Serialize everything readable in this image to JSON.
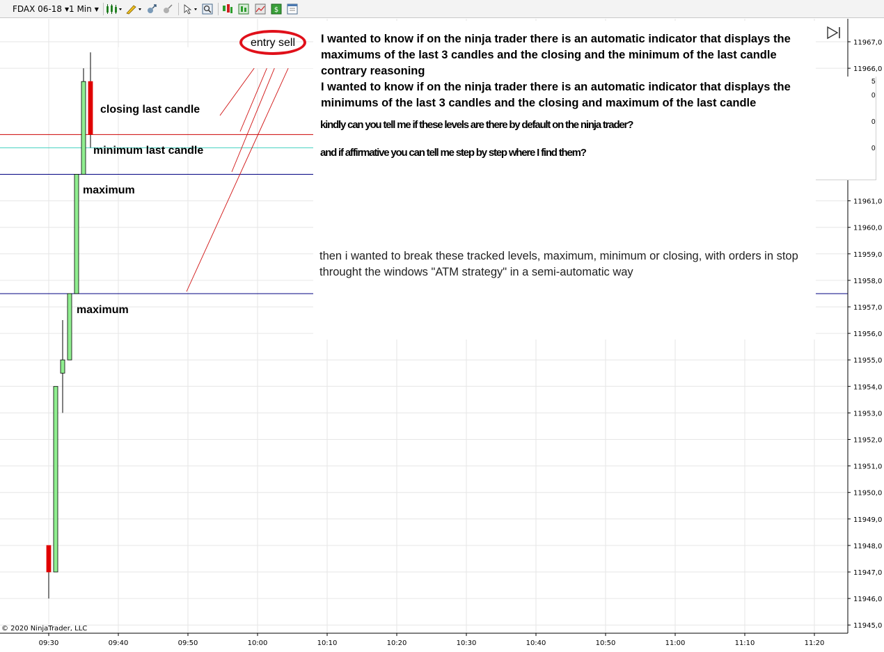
{
  "toolbar": {
    "instrument": "FDAX 06-18",
    "interval": "1 Min",
    "icons": [
      "bar-style-icon",
      "drawing-tools-icon",
      "snap-mode-icon",
      "pan-icon",
      "select-icon",
      "zoom-icon",
      "indicators-icon",
      "strategies-icon",
      "templates-icon",
      "order-entry-icon",
      "properties-icon"
    ]
  },
  "chart_data": {
    "type": "candlestick",
    "y_ticks": [
      "11967,0",
      "11966,0",
      "11961,0",
      "11960,0",
      "11959,0",
      "11958,0",
      "11957,0",
      "11956,0",
      "11955,0",
      "11954,0",
      "11953,0",
      "11952,0",
      "11951,0",
      "11950,0",
      "11949,0",
      "11948,0",
      "11947,0",
      "11946,0",
      "11945,0"
    ],
    "x_ticks": [
      "09:30",
      "09:40",
      "09:50",
      "10:00",
      "10:10",
      "10:20",
      "10:30",
      "10:40",
      "10:50",
      "11:00",
      "11:10",
      "11:20"
    ],
    "ylim": [
      11944.8,
      11967.4
    ],
    "candles": [
      {
        "time": "09:30",
        "open": 11948.0,
        "high": 11948.0,
        "low": 11946.0,
        "close": 11947.0
      },
      {
        "time": "09:31",
        "open": 11947.0,
        "high": 11954.0,
        "low": 11947.0,
        "close": 11954.0
      },
      {
        "time": "09:32",
        "open": 11954.5,
        "high": 11956.5,
        "low": 11953.0,
        "close": 11955.0
      },
      {
        "time": "09:33",
        "open": 11955.0,
        "high": 11957.5,
        "low": 11955.0,
        "close": 11957.5
      },
      {
        "time": "09:34",
        "open": 11957.5,
        "high": 11962.0,
        "low": 11957.5,
        "close": 11962.0
      },
      {
        "time": "09:35",
        "open": 11962.0,
        "high": 11966.0,
        "low": 11962.0,
        "close": 11965.5
      },
      {
        "time": "09:36",
        "open": 11965.5,
        "high": 11966.6,
        "low": 11963.0,
        "close": 11963.5
      }
    ],
    "levels": [
      {
        "name": "closing last candle",
        "price": 11963.5,
        "color": "#cc0000"
      },
      {
        "name": "minimum last candle",
        "price": 11963.0,
        "color": "#40d0c0"
      },
      {
        "name": "maximum",
        "price": 11962.0,
        "color": "#000080"
      },
      {
        "name": "maximum",
        "price": 11957.5,
        "color": "#000080"
      }
    ],
    "colors": {
      "up": "#90ee90",
      "down": "#e00000",
      "grid": "#e6e6e6",
      "wick": "#000000"
    }
  },
  "annotations": {
    "entry_sell": "entry sell",
    "closing_last_candle": "closing last candle",
    "minimum_last_candle": "minimum last candle",
    "maximum_upper": "maximum",
    "maximum_lower": "maximum",
    "question_line1": "I wanted to know if on the ninja trader there is an automatic indicator that displays the maximums of the last 3 candles and the closing and the minimum of the last candle",
    "question_line2": "contrary reasoning",
    "question_line3": "I wanted to know if on the ninja trader there is an automatic indicator that displays the minimums of the last 3 candles and the closing and maximum of the last candle",
    "question_line4": "kindly can you tell me if these levels are there by default on the ninja trader?",
    "question_line5": "and if affirmative you can tell me step by step where I find them?",
    "followup": "then i wanted to break these tracked levels, maximum, minimum or closing, with orders in stop throught the windows \"ATM strategy\" in a semi-automatic way"
  },
  "right_panel_fragments": [
    "5",
    "0",
    "0",
    "0"
  ],
  "copyright": "© 2020 NinjaTrader, LLC"
}
